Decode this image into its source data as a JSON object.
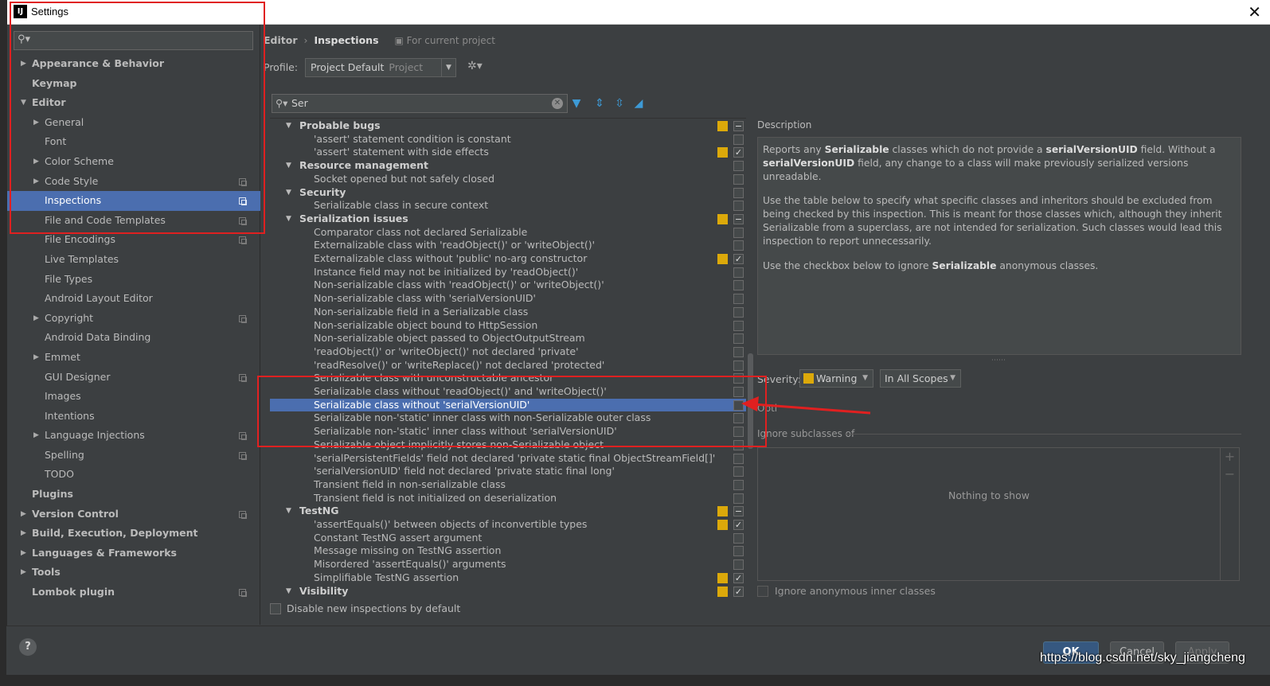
{
  "window": {
    "title": "Settings",
    "app_icon": "IJ"
  },
  "sidebar": {
    "search_placeholder": "",
    "items": [
      {
        "label": "Appearance & Behavior",
        "level": 0,
        "arrow": "collapsed",
        "bold": true,
        "cfg": false,
        "selected": false
      },
      {
        "label": "Keymap",
        "level": 0,
        "arrow": "none",
        "bold": true,
        "cfg": false,
        "selected": false
      },
      {
        "label": "Editor",
        "level": 0,
        "arrow": "expanded",
        "bold": true,
        "cfg": false,
        "selected": false
      },
      {
        "label": "General",
        "level": 1,
        "arrow": "collapsed",
        "bold": false,
        "cfg": false,
        "selected": false
      },
      {
        "label": "Font",
        "level": 1,
        "arrow": "none",
        "bold": false,
        "cfg": false,
        "selected": false
      },
      {
        "label": "Color Scheme",
        "level": 1,
        "arrow": "collapsed",
        "bold": false,
        "cfg": false,
        "selected": false
      },
      {
        "label": "Code Style",
        "level": 1,
        "arrow": "collapsed",
        "bold": false,
        "cfg": true,
        "selected": false
      },
      {
        "label": "Inspections",
        "level": 1,
        "arrow": "none",
        "bold": false,
        "cfg": true,
        "selected": true
      },
      {
        "label": "File and Code Templates",
        "level": 1,
        "arrow": "none",
        "bold": false,
        "cfg": true,
        "selected": false
      },
      {
        "label": "File Encodings",
        "level": 1,
        "arrow": "none",
        "bold": false,
        "cfg": true,
        "selected": false
      },
      {
        "label": "Live Templates",
        "level": 1,
        "arrow": "none",
        "bold": false,
        "cfg": false,
        "selected": false
      },
      {
        "label": "File Types",
        "level": 1,
        "arrow": "none",
        "bold": false,
        "cfg": false,
        "selected": false
      },
      {
        "label": "Android Layout Editor",
        "level": 1,
        "arrow": "none",
        "bold": false,
        "cfg": false,
        "selected": false
      },
      {
        "label": "Copyright",
        "level": 1,
        "arrow": "collapsed",
        "bold": false,
        "cfg": true,
        "selected": false
      },
      {
        "label": "Android Data Binding",
        "level": 1,
        "arrow": "none",
        "bold": false,
        "cfg": false,
        "selected": false
      },
      {
        "label": "Emmet",
        "level": 1,
        "arrow": "collapsed",
        "bold": false,
        "cfg": false,
        "selected": false
      },
      {
        "label": "GUI Designer",
        "level": 1,
        "arrow": "none",
        "bold": false,
        "cfg": true,
        "selected": false
      },
      {
        "label": "Images",
        "level": 1,
        "arrow": "none",
        "bold": false,
        "cfg": false,
        "selected": false
      },
      {
        "label": "Intentions",
        "level": 1,
        "arrow": "none",
        "bold": false,
        "cfg": false,
        "selected": false
      },
      {
        "label": "Language Injections",
        "level": 1,
        "arrow": "collapsed",
        "bold": false,
        "cfg": true,
        "selected": false
      },
      {
        "label": "Spelling",
        "level": 1,
        "arrow": "none",
        "bold": false,
        "cfg": true,
        "selected": false
      },
      {
        "label": "TODO",
        "level": 1,
        "arrow": "none",
        "bold": false,
        "cfg": false,
        "selected": false
      },
      {
        "label": "Plugins",
        "level": 0,
        "arrow": "none",
        "bold": true,
        "cfg": false,
        "selected": false
      },
      {
        "label": "Version Control",
        "level": 0,
        "arrow": "collapsed",
        "bold": true,
        "cfg": true,
        "selected": false
      },
      {
        "label": "Build, Execution, Deployment",
        "level": 0,
        "arrow": "collapsed",
        "bold": true,
        "cfg": false,
        "selected": false
      },
      {
        "label": "Languages & Frameworks",
        "level": 0,
        "arrow": "collapsed",
        "bold": true,
        "cfg": false,
        "selected": false
      },
      {
        "label": "Tools",
        "level": 0,
        "arrow": "collapsed",
        "bold": true,
        "cfg": false,
        "selected": false
      },
      {
        "label": "Lombok plugin",
        "level": 0,
        "arrow": "none",
        "bold": true,
        "cfg": true,
        "selected": false
      }
    ]
  },
  "breadcrumb": {
    "parent": "Editor",
    "current": "Inspections",
    "project_hint": "For current project"
  },
  "profile": {
    "label": "Profile:",
    "value": "Project Default",
    "scope": "Project"
  },
  "inspection_search": {
    "value": "Ser"
  },
  "inspections": [
    {
      "label": "Probable bugs",
      "category": true,
      "sev": true,
      "check": "mixed",
      "selected": false
    },
    {
      "label": "'assert' statement condition is constant",
      "category": false,
      "sev": false,
      "check": "off",
      "selected": false
    },
    {
      "label": "'assert' statement with side effects",
      "category": false,
      "sev": true,
      "check": "on",
      "selected": false
    },
    {
      "label": "Resource management",
      "category": true,
      "sev": false,
      "check": "off",
      "selected": false
    },
    {
      "label": "Socket opened but not safely closed",
      "category": false,
      "sev": false,
      "check": "off",
      "selected": false
    },
    {
      "label": "Security",
      "category": true,
      "sev": false,
      "check": "off",
      "selected": false
    },
    {
      "label": "Serializable class in secure context",
      "category": false,
      "sev": false,
      "check": "off",
      "selected": false
    },
    {
      "label": "Serialization issues",
      "category": true,
      "sev": true,
      "check": "mixed",
      "selected": false
    },
    {
      "label": "Comparator class not declared Serializable",
      "category": false,
      "sev": false,
      "check": "off",
      "selected": false
    },
    {
      "label": "Externalizable class with 'readObject()' or 'writeObject()'",
      "category": false,
      "sev": false,
      "check": "off",
      "selected": false
    },
    {
      "label": "Externalizable class without 'public' no-arg constructor",
      "category": false,
      "sev": true,
      "check": "on",
      "selected": false
    },
    {
      "label": "Instance field may not be initialized by 'readObject()'",
      "category": false,
      "sev": false,
      "check": "off",
      "selected": false
    },
    {
      "label": "Non-serializable class with 'readObject()' or 'writeObject()'",
      "category": false,
      "sev": false,
      "check": "off",
      "selected": false
    },
    {
      "label": "Non-serializable class with 'serialVersionUID'",
      "category": false,
      "sev": false,
      "check": "off",
      "selected": false
    },
    {
      "label": "Non-serializable field in a Serializable class",
      "category": false,
      "sev": false,
      "check": "off",
      "selected": false
    },
    {
      "label": "Non-serializable object bound to HttpSession",
      "category": false,
      "sev": false,
      "check": "off",
      "selected": false
    },
    {
      "label": "Non-serializable object passed to ObjectOutputStream",
      "category": false,
      "sev": false,
      "check": "off",
      "selected": false
    },
    {
      "label": "'readObject()' or 'writeObject()' not declared 'private'",
      "category": false,
      "sev": false,
      "check": "off",
      "selected": false
    },
    {
      "label": "'readResolve()' or 'writeReplace()' not declared 'protected'",
      "category": false,
      "sev": false,
      "check": "off",
      "selected": false
    },
    {
      "label": "Serializable class with unconstructable ancestor",
      "category": false,
      "sev": false,
      "check": "off",
      "selected": false
    },
    {
      "label": "Serializable class without 'readObject()' and 'writeObject()'",
      "category": false,
      "sev": false,
      "check": "off",
      "selected": false
    },
    {
      "label": "Serializable class without 'serialVersionUID'",
      "category": false,
      "sev": false,
      "check": "off",
      "selected": true
    },
    {
      "label": "Serializable non-'static' inner class with non-Serializable outer class",
      "category": false,
      "sev": false,
      "check": "off",
      "selected": false
    },
    {
      "label": "Serializable non-'static' inner class without 'serialVersionUID'",
      "category": false,
      "sev": false,
      "check": "off",
      "selected": false
    },
    {
      "label": "Serializable object implicitly stores non-Serializable object",
      "category": false,
      "sev": false,
      "check": "off",
      "selected": false
    },
    {
      "label": "'serialPersistentFields' field not declared 'private static final ObjectStreamField[]'",
      "category": false,
      "sev": false,
      "check": "off",
      "selected": false
    },
    {
      "label": "'serialVersionUID' field not declared 'private static final long'",
      "category": false,
      "sev": false,
      "check": "off",
      "selected": false
    },
    {
      "label": "Transient field in non-serializable class",
      "category": false,
      "sev": false,
      "check": "off",
      "selected": false
    },
    {
      "label": "Transient field is not initialized on deserialization",
      "category": false,
      "sev": false,
      "check": "off",
      "selected": false
    },
    {
      "label": "TestNG",
      "category": true,
      "sev": true,
      "check": "mixed",
      "selected": false
    },
    {
      "label": "'assertEquals()' between objects of inconvertible types",
      "category": false,
      "sev": true,
      "check": "on",
      "selected": false
    },
    {
      "label": "Constant TestNG assert argument",
      "category": false,
      "sev": false,
      "check": "off",
      "selected": false
    },
    {
      "label": "Message missing on TestNG assertion",
      "category": false,
      "sev": false,
      "check": "off",
      "selected": false
    },
    {
      "label": "Misordered 'assertEquals()' arguments",
      "category": false,
      "sev": false,
      "check": "off",
      "selected": false
    },
    {
      "label": "Simplifiable TestNG assertion",
      "category": false,
      "sev": true,
      "check": "on",
      "selected": false
    },
    {
      "label": "Visibility",
      "category": true,
      "sev": true,
      "check": "on",
      "selected": false
    }
  ],
  "disable_new": {
    "label": "Disable new inspections by default",
    "checked": false
  },
  "description": {
    "title": "Description",
    "p1_a": "Reports any ",
    "p1_b": "Serializable",
    "p1_c": " classes which do not provide a ",
    "p1_d": "serialVersionUID",
    "p1_e": " field. Without a ",
    "p1_f": "serialVersionUID",
    "p1_g": " field, any change to a class will make previously serialized versions unreadable.",
    "p2": "Use the table below to specify what specific classes and inheritors should be excluded from being checked by this inspection. This is meant for those classes which, although they inherit Serializable from a superclass, are not intended for serialization. Such classes would lead this inspection to report unnecessarily.",
    "p3_a": "Use the checkbox below to ignore ",
    "p3_b": "Serializable",
    "p3_c": " anonymous classes."
  },
  "severity": {
    "label": "Severity:",
    "value": "Warning",
    "scope": "In All Scopes",
    "color": "#dca90a"
  },
  "options": {
    "label": "Opti",
    "ignore_subclasses_label": "Ignore subclasses of",
    "empty_text": "Nothing to show",
    "ignore_anonymous_label": "Ignore anonymous inner classes"
  },
  "buttons": {
    "help": "?",
    "ok": "OK",
    "cancel": "Cancel",
    "apply": "Apply"
  },
  "watermark": "https://blog.csdn.net/sky_jiangcheng",
  "colors": {
    "selection": "#4b6eaf",
    "annotation": "#e02020",
    "severity_warning": "#dca90a"
  }
}
